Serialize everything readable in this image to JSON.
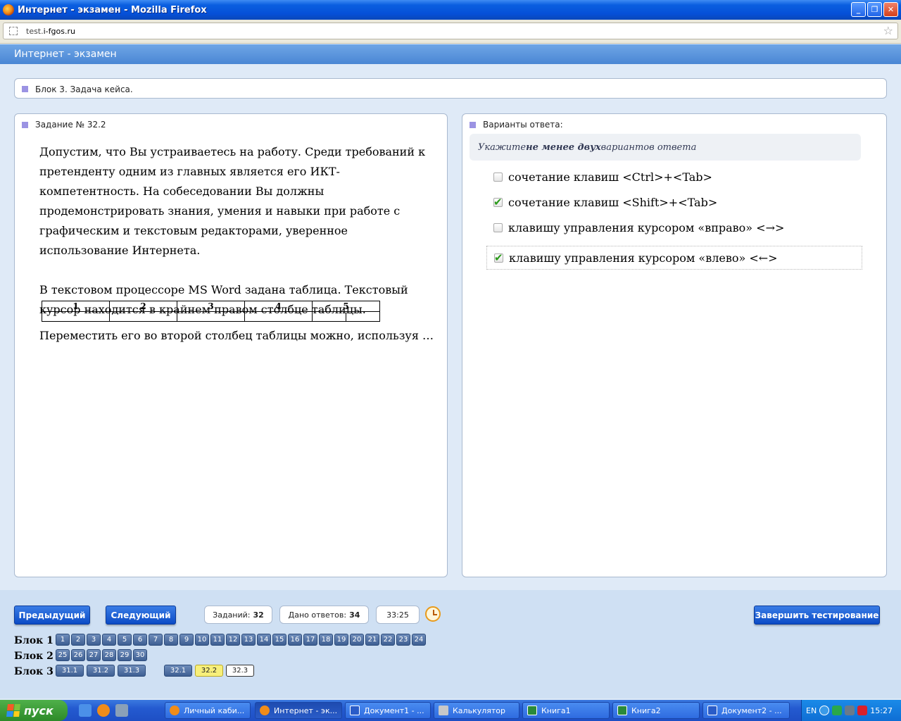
{
  "window": {
    "title": "Интернет - экзамен - Mozilla Firefox",
    "buttons": {
      "minimize": "_",
      "maximize": "❐",
      "close": "✕"
    }
  },
  "browser": {
    "url_prefix": "test.",
    "url_domain": "i-fgos.ru"
  },
  "app": {
    "title": "Интернет - экзамен"
  },
  "block_bar": {
    "label": "Блок 3. Задача кейса."
  },
  "task": {
    "header": "Задание № 32.2",
    "para1": "Допустим, что Вы устраиваетесь на работу. Среди требований к претенденту одним из главных является его ИКТ-компетентность. На собеседовании Вы должны продемонстрировать знания, умения и навыки при работе с графическим и текстовым редакторами, уверенное использование Интернета.",
    "para2": "В текстовом процессоре MS Word задана таблица. Текстовый курсор находится в крайнем правом столбце таблицы.",
    "table_headers": [
      "1",
      "2",
      "3",
      "4",
      "5"
    ],
    "para3": "Переместить его во второй столбец таблицы можно, используя …"
  },
  "answers": {
    "header": "Варианты ответа:",
    "hint_pre": "Укажите ",
    "hint_bold": "не менее двух",
    "hint_post": " вариантов ответа",
    "options": [
      {
        "text": "сочетание клавиш <Ctrl>+<Tab>",
        "checked": false
      },
      {
        "text": "сочетание клавиш <Shift>+<Tab>",
        "checked": true
      },
      {
        "text": "клавишу управления курсором «вправо» <→>",
        "checked": false
      },
      {
        "text": "клавишу управления курсором «влево» <←>",
        "checked": true
      }
    ]
  },
  "controls": {
    "prev": "Предыдущий",
    "next": "Следующий",
    "tasks_label": "Заданий:",
    "tasks_count": "32",
    "answers_label": "Дано ответов:",
    "answers_count": "34",
    "timer": "33:25",
    "finish": "Завершить тестирование"
  },
  "navigation": {
    "block1_label": "Блок 1",
    "block2_label": "Блок 2",
    "block3_label": "Блок 3",
    "block1": [
      "1",
      "2",
      "3",
      "4",
      "5",
      "6",
      "7",
      "8",
      "9",
      "10",
      "11",
      "12",
      "13",
      "14",
      "15",
      "16",
      "17",
      "18",
      "19",
      "20",
      "21",
      "22",
      "23",
      "24"
    ],
    "block2": [
      "25",
      "26",
      "27",
      "28",
      "29",
      "30"
    ],
    "block3": [
      "31.1",
      "31.2",
      "31.3",
      "32.1",
      "32.2",
      "32.3"
    ],
    "current": "32.2"
  },
  "taskbar": {
    "start": "пуск",
    "tasks": [
      "Личный каби...",
      "Интернет - эк...",
      "Документ1 - ...",
      "Калькулятор",
      "Книга1",
      "Книга2",
      "Документ2 - ..."
    ],
    "lang": "EN",
    "time": "15:27"
  }
}
